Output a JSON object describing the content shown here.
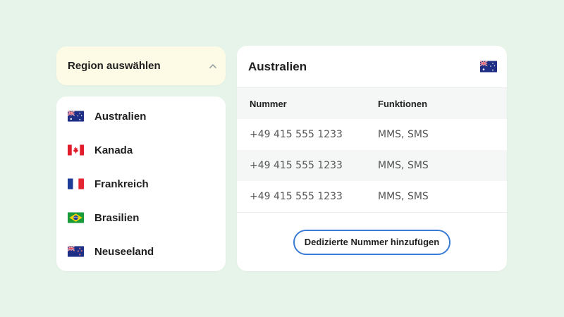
{
  "region_select": {
    "label": "Region auswählen",
    "icon": "chevron-up-icon"
  },
  "regions": [
    {
      "name": "Australien",
      "flag": "australia-flag-icon"
    },
    {
      "name": "Kanada",
      "flag": "canada-flag-icon"
    },
    {
      "name": "Frankreich",
      "flag": "france-flag-icon"
    },
    {
      "name": "Brasilien",
      "flag": "brazil-flag-icon"
    },
    {
      "name": "Neuseeland",
      "flag": "new-zealand-flag-icon"
    }
  ],
  "detail": {
    "title": "Australien",
    "flag": "australia-flag-icon",
    "columns": [
      "Nummer",
      "Funktionen"
    ],
    "rows": [
      {
        "number": "+49 415 555 1233",
        "features": "MMS, SMS"
      },
      {
        "number": "+49 415 555 1233",
        "features": "MMS, SMS"
      },
      {
        "number": "+49 415 555 1233",
        "features": "MMS, SMS"
      }
    ],
    "add_button": "Dedizierte Nummer hinzufügen"
  },
  "colors": {
    "background": "#e6f4ea",
    "select_bg": "#fdfbe6",
    "button_border": "#3a7bd5",
    "table_alt_row": "#f5f7f7"
  }
}
